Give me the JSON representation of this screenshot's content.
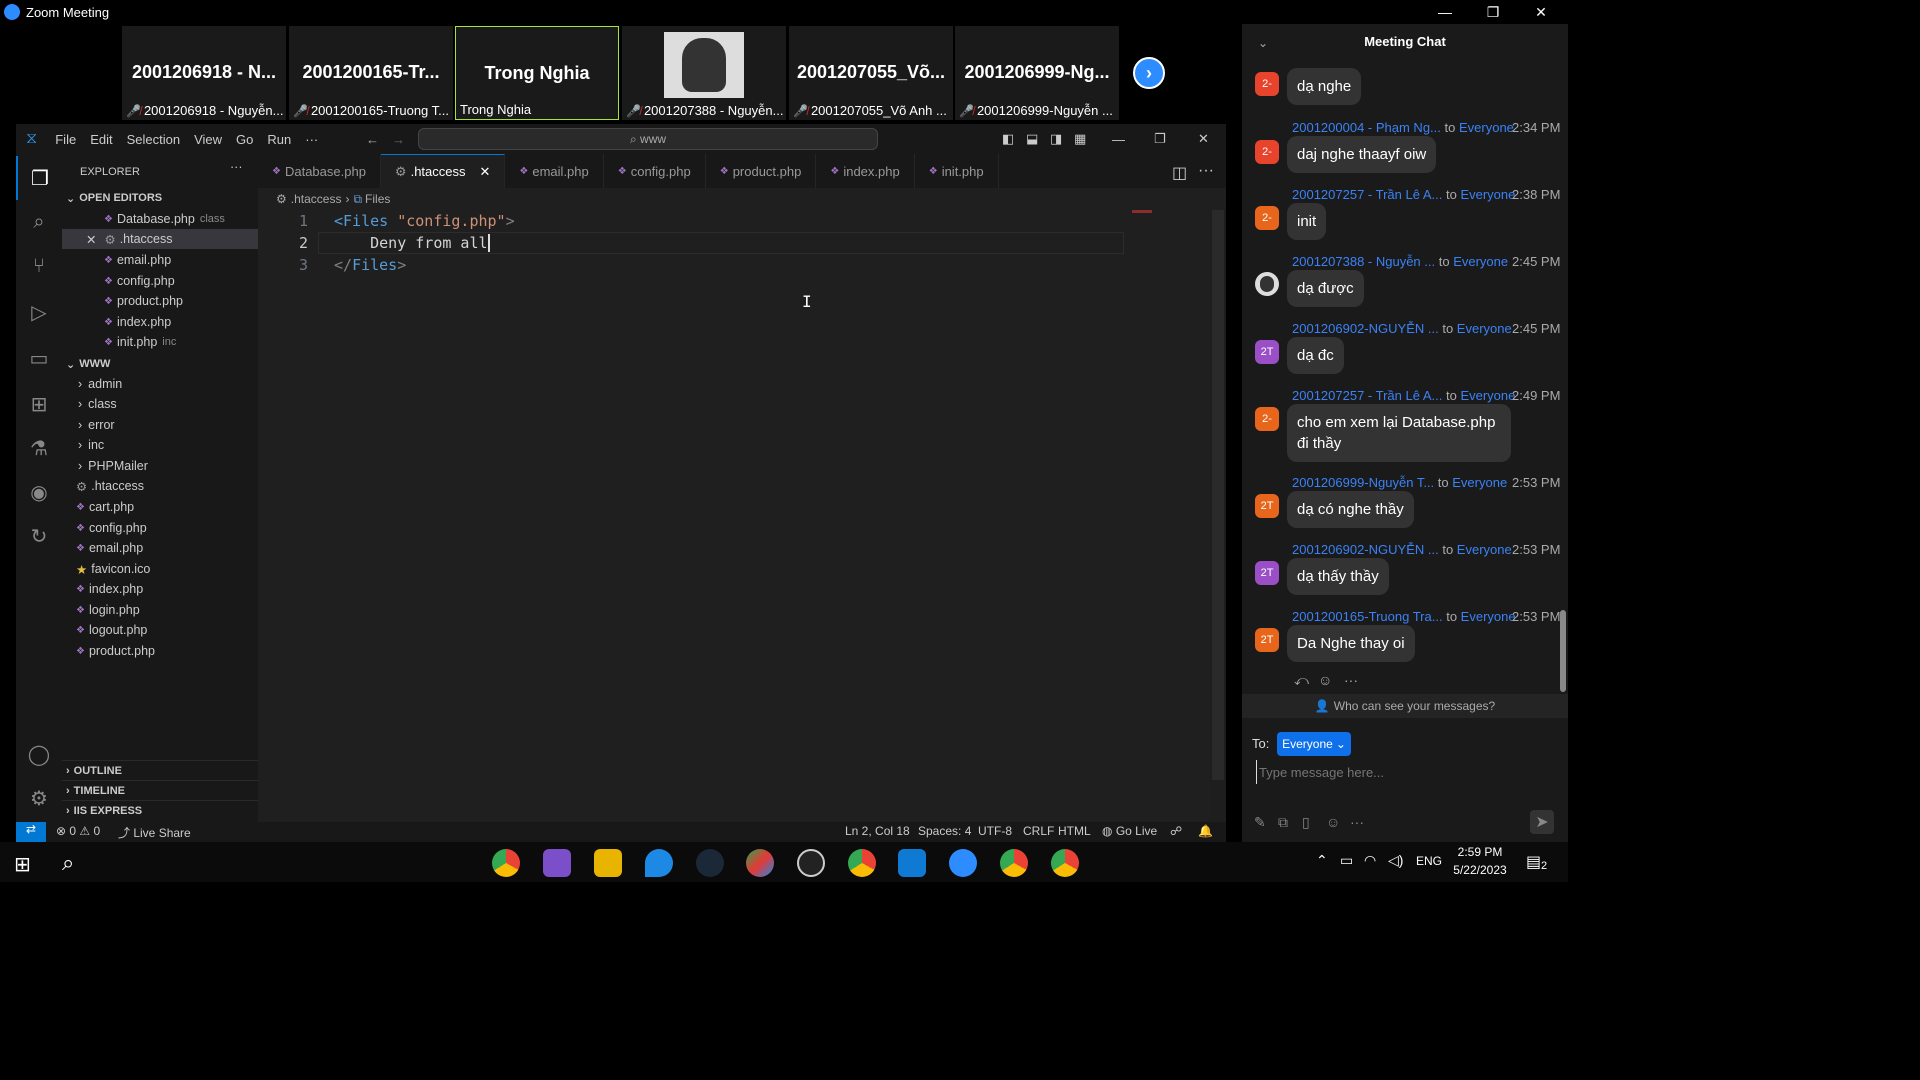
{
  "zoom": {
    "window_title": "Zoom Meeting",
    "minimize": "—",
    "restore": "❐",
    "close": "✕"
  },
  "participants": [
    {
      "big": "2001206918 - N...",
      "small": "2001206918 - Nguyễn..."
    },
    {
      "big": "2001200165-Tr...",
      "small": "2001200165-Truong T..."
    },
    {
      "big": "Trong Nghia",
      "small": "Trong Nghia"
    },
    {
      "big": "",
      "small": "2001207388 - Nguyễn..."
    },
    {
      "big": "2001207055_Võ...",
      "small": "2001207055_Võ Anh ..."
    },
    {
      "big": "2001206999-Ng...",
      "small": "2001206999-Nguyễn ..."
    }
  ],
  "vscode": {
    "menu": [
      "File",
      "Edit",
      "Selection",
      "View",
      "Go",
      "Run",
      "···"
    ],
    "search": "www",
    "explorer_title": "EXPLORER",
    "open_editors_label": "OPEN EDITORS",
    "open_editors": [
      {
        "name": "Database.php",
        "hint": "class"
      },
      {
        "name": ".htaccess",
        "hint": ""
      },
      {
        "name": "email.php",
        "hint": ""
      },
      {
        "name": "config.php",
        "hint": ""
      },
      {
        "name": "product.php",
        "hint": ""
      },
      {
        "name": "index.php",
        "hint": ""
      },
      {
        "name": "init.php",
        "hint": "inc"
      }
    ],
    "folder_label": "WWW",
    "folders": [
      "admin",
      "class",
      "error",
      "inc",
      "PHPMailer"
    ],
    "files": [
      ".htaccess",
      "cart.php",
      "config.php",
      "email.php",
      "favicon.ico",
      "index.php",
      "login.php",
      "logout.php",
      "product.php"
    ],
    "outline": "OUTLINE",
    "timeline": "TIMELINE",
    "iis": "IIS EXPRESS",
    "tabs": [
      "Database.php",
      ".htaccess",
      "email.php",
      "config.php",
      "product.php",
      "index.php",
      "init.php"
    ],
    "breadcrumb": [
      ".htaccess",
      "Files"
    ],
    "code_lines": [
      {
        "n": "1",
        "text": "<Files \"config.php\">"
      },
      {
        "n": "2",
        "text": "    Deny from all"
      },
      {
        "n": "3",
        "text": "</Files>"
      }
    ],
    "status": {
      "errors": "⊗ 0 ⚠ 0",
      "live_share": "Live Share",
      "position": "Ln 2, Col 18",
      "spaces": "Spaces: 4",
      "encoding": "UTF-8",
      "eol": "CRLF",
      "language": "HTML",
      "go_live": "Go Live"
    }
  },
  "chat": {
    "title": "Meeting Chat",
    "messages": [
      {
        "sender": "",
        "time": "",
        "text": "dạ nghe",
        "avatar": "2-",
        "color": "#e8432c"
      },
      {
        "sender": "2001200004 - Phạm Ng...",
        "time": "2:34 PM",
        "text": "daj nghe thaayf oiw",
        "avatar": "2-",
        "color": "#e8432c"
      },
      {
        "sender": "2001207257 - Trần Lê A...",
        "time": "2:38 PM",
        "text": "init",
        "avatar": "2-",
        "color": "#e8661c"
      },
      {
        "sender": "2001207388 - Nguyễn ...",
        "time": "2:45 PM",
        "text": "dạ được",
        "avatar": "",
        "color": "#888888"
      },
      {
        "sender": "2001206902-NGUYỄN ...",
        "time": "2:45 PM",
        "text": "dạ đc",
        "avatar": "2T",
        "color": "#9b4fc7"
      },
      {
        "sender": "2001207257 - Trần Lê A...",
        "time": "2:49 PM",
        "text": "cho em xem lại Database.php đi thầy",
        "avatar": "2-",
        "color": "#e8661c"
      },
      {
        "sender": "2001206999-Nguyễn T...",
        "time": "2:53 PM",
        "text": "dạ có nghe thầy",
        "avatar": "2T",
        "color": "#e8661c"
      },
      {
        "sender": "2001206902-NGUYỄN ...",
        "time": "2:53 PM",
        "text": "dạ thấy thầy",
        "avatar": "2T",
        "color": "#9b4fc7"
      },
      {
        "sender": "2001200165-Truong Tra...",
        "time": "2:53 PM",
        "text": "Da Nghe thay oi",
        "avatar": "2T",
        "color": "#e8661c"
      }
    ],
    "to_word": "to",
    "everyone": "Everyone",
    "who_can_see": "Who can see your messages?",
    "to_label": "To:",
    "recipient": "Everyone",
    "placeholder": "Type message here..."
  },
  "taskbar": {
    "time": "2:59 PM",
    "date": "5/22/2023",
    "lang": "ENG",
    "notif": "2"
  }
}
